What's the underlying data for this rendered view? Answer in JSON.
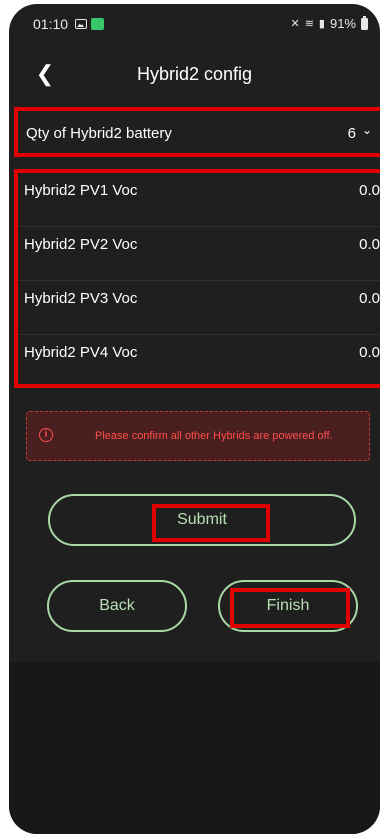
{
  "status_bar": {
    "time": "01:10",
    "battery": "91%"
  },
  "header": {
    "title": "Hybrid2 config"
  },
  "qty": {
    "label": "Qty of Hybrid2 battery",
    "value": "6"
  },
  "pv_rows": [
    {
      "label": "Hybrid2 PV1 Voc",
      "value": "0.0"
    },
    {
      "label": "Hybrid2 PV2 Voc",
      "value": "0.0"
    },
    {
      "label": "Hybrid2 PV3 Voc",
      "value": "0.0"
    },
    {
      "label": "Hybrid2 PV4 Voc",
      "value": "0.0"
    }
  ],
  "warning": {
    "text": "Please confirm all other Hybrids are powered off."
  },
  "buttons": {
    "submit": "Submit",
    "back": "Back",
    "finish": "Finish"
  },
  "colors": {
    "background": "#1f1f1f",
    "highlight": "#e10000",
    "button_border": "#a7d8a6",
    "warning_text": "#ff4d4d"
  }
}
